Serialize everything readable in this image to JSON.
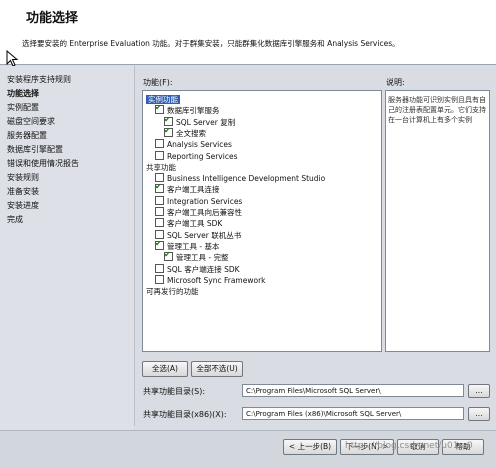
{
  "header": {
    "title": "功能选择",
    "description": "选择要安装的 Enterprise Evaluation 功能。对于群集安装，只能群集化数据库引擎服务和 Analysis Services。"
  },
  "nav": {
    "items": [
      "安装程序支持规则",
      "功能选择",
      "实例配置",
      "磁盘空间要求",
      "服务器配置",
      "数据库引擎配置",
      "错误和使用情况报告",
      "安装规则",
      "准备安装",
      "安装进度",
      "完成"
    ]
  },
  "features_label": "功能(F):",
  "description_label": "说明:",
  "description_text": "服务器功能可识别实例且具有自己的注册表配置单元。它们支持在一台计算机上有多个实例",
  "features": [
    {
      "label": "实例功能",
      "checked": null,
      "indent": 0,
      "selected": true
    },
    {
      "label": "数据库引擎服务",
      "checked": true,
      "indent": 1
    },
    {
      "label": "SQL Server 复制",
      "checked": true,
      "indent": 2
    },
    {
      "label": "全文搜索",
      "checked": true,
      "indent": 2
    },
    {
      "label": "Analysis Services",
      "checked": false,
      "indent": 1
    },
    {
      "label": "Reporting Services",
      "checked": false,
      "indent": 1
    },
    {
      "label": "共享功能",
      "checked": null,
      "indent": 0
    },
    {
      "label": "Business Intelligence Development Studio",
      "checked": false,
      "indent": 1
    },
    {
      "label": "客户端工具连接",
      "checked": true,
      "indent": 1
    },
    {
      "label": "Integration Services",
      "checked": false,
      "indent": 1
    },
    {
      "label": "客户端工具向后兼容性",
      "checked": false,
      "indent": 1
    },
    {
      "label": "客户端工具 SDK",
      "checked": false,
      "indent": 1
    },
    {
      "label": "SQL Server 联机丛书",
      "checked": false,
      "indent": 1
    },
    {
      "label": "管理工具 - 基本",
      "checked": true,
      "indent": 1
    },
    {
      "label": "管理工具 - 完整",
      "checked": true,
      "indent": 2
    },
    {
      "label": "SQL 客户端连接 SDK",
      "checked": false,
      "indent": 1
    },
    {
      "label": "Microsoft Sync Framework",
      "checked": false,
      "indent": 1
    },
    {
      "label": "可再发行的功能",
      "checked": null,
      "indent": 0
    }
  ],
  "buttons": {
    "select_all": "全选(A)",
    "unselect_all": "全部不选(U)",
    "browse": "...",
    "back": "< 上一步(B)",
    "next": "下一步(N) >",
    "cancel": "取消",
    "help": "帮助"
  },
  "shared_dir": {
    "label": "共享功能目录(S):",
    "value": "C:\\Program Files\\Microsoft SQL Server\\"
  },
  "shared_dir_x86": {
    "label": "共享功能目录(x86)(X):",
    "value": "C:\\Program Files (x86)\\Microsoft SQL Server\\"
  },
  "watermark": "https://blog.csdn.net/u01...0"
}
